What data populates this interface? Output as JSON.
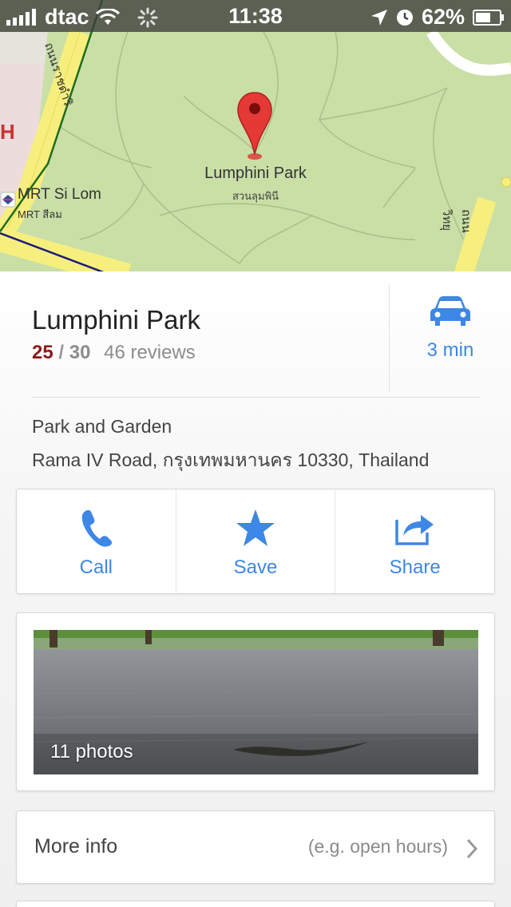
{
  "status_bar": {
    "carrier": "dtac",
    "time": "11:38",
    "battery": "62%",
    "icons": [
      "signal-bars-icon",
      "wifi-icon",
      "activity-spinner-icon",
      "location-arrow-icon",
      "alarm-clock-icon",
      "battery-icon"
    ]
  },
  "map": {
    "place_label": "Lumphini Park",
    "place_label_th": "สวนลุมพินี",
    "station_label": "MRT Si Lom",
    "station_label_th": "MRT สีลม",
    "road_left": "ถนนราชดำริ",
    "road_right": "ถนนวิทยุ",
    "edge_letter": "H",
    "colors": {
      "park": "#c9dfa6",
      "road": "#f7ef7d",
      "pin": "#e53935"
    }
  },
  "place": {
    "title": "Lumphini Park",
    "score": "25",
    "slash": "/",
    "total": "30",
    "reviews": "46 reviews",
    "category": "Park and Garden",
    "address": "Rama IV Road, กรุงเทพมหานคร 10330, Thailand",
    "drive_time": "3 min",
    "drive_icon": "car-icon"
  },
  "actions": {
    "call": "Call",
    "save": "Save",
    "share": "Share"
  },
  "photos": {
    "count_label": "11 photos"
  },
  "more_info": {
    "label": "More info",
    "hint": "(e.g. open hours)"
  },
  "colors": {
    "accent": "#3d87e6",
    "score": "#8b1a1a"
  }
}
